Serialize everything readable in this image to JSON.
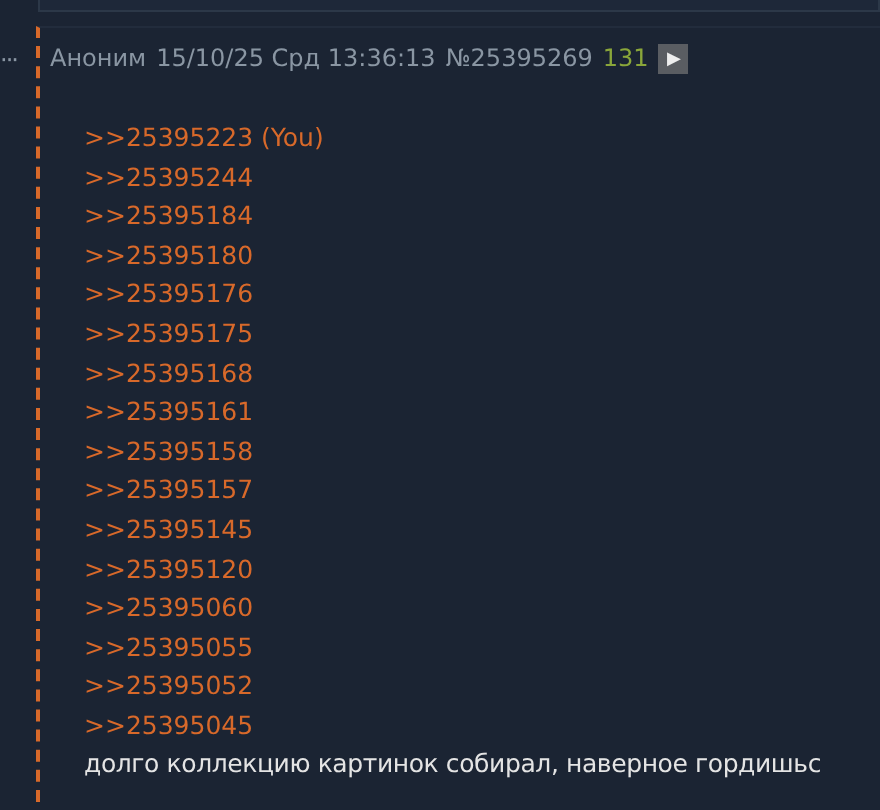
{
  "more_icon": "···",
  "post": {
    "author": "Аноним",
    "date": "15/10/25 Срд 13:36:13",
    "number": "№25395269",
    "count": "131",
    "play_button": "▶",
    "replies": [
      {
        "text": ">>25395223 (You)"
      },
      {
        "text": ">>25395244"
      },
      {
        "text": ">>25395184"
      },
      {
        "text": ">>25395180"
      },
      {
        "text": ">>25395176"
      },
      {
        "text": ">>25395175"
      },
      {
        "text": ">>25395168"
      },
      {
        "text": ">>25395161"
      },
      {
        "text": ">>25395158"
      },
      {
        "text": ">>25395157"
      },
      {
        "text": ">>25395145"
      },
      {
        "text": ">>25395120"
      },
      {
        "text": ">>25395060"
      },
      {
        "text": ">>25395055"
      },
      {
        "text": ">>25395052"
      },
      {
        "text": ">>25395045"
      }
    ],
    "message": "долго коллекцию картинок собирал, наверное гордишьс"
  }
}
